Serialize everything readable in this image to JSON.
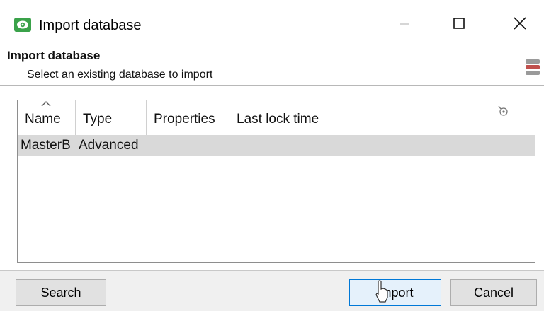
{
  "window": {
    "title": "Import database",
    "accent_color": "#3aa24a"
  },
  "header": {
    "title": "Import database",
    "subtitle": "Select an existing database to import"
  },
  "list": {
    "columns": [
      "Name",
      "Type",
      "Properties",
      "Last lock time"
    ],
    "rows": [
      {
        "name": "MasterB",
        "type": "Advanced",
        "properties": "",
        "last_lock_time": ""
      }
    ]
  },
  "buttons": {
    "search": "Search",
    "import": "Import",
    "cancel": "Cancel"
  },
  "icons": {
    "app": "eye-icon",
    "database": "database-icon",
    "filter": "column-filter-icon"
  }
}
